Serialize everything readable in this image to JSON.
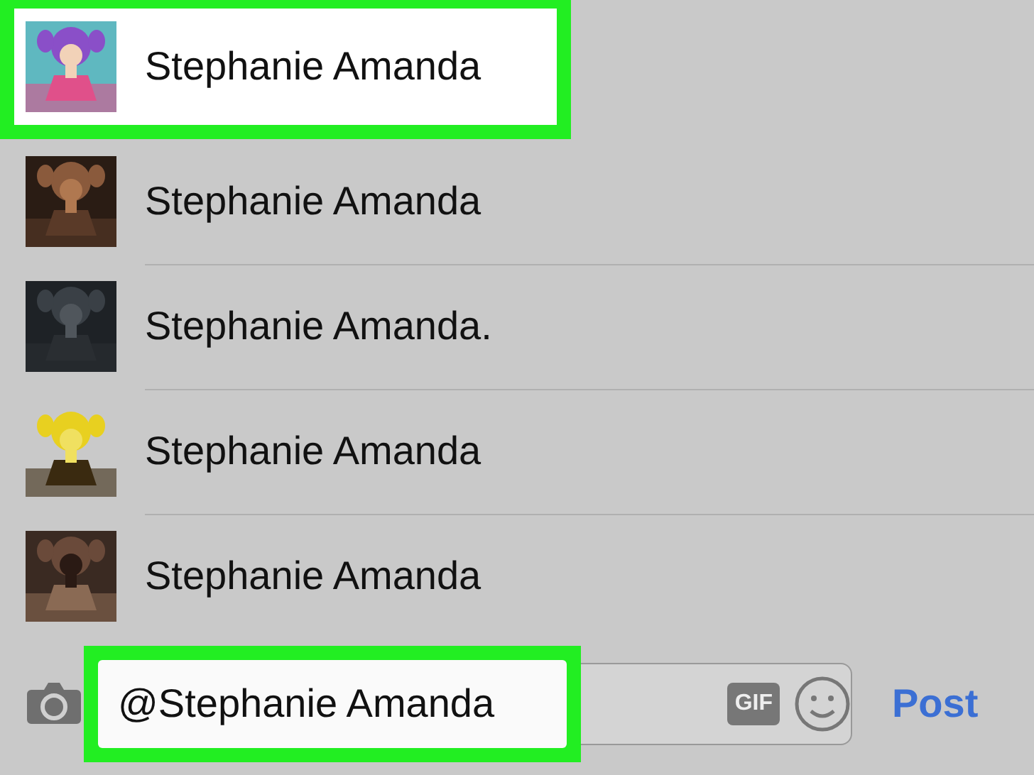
{
  "suggestions": [
    {
      "name": "Stephanie Amanda",
      "selected": true
    },
    {
      "name": "Stephanie Amanda",
      "selected": false
    },
    {
      "name": "Stephanie Amanda.",
      "selected": false
    },
    {
      "name": "Stephanie Amanda",
      "selected": false
    },
    {
      "name": "Stephanie Amanda",
      "selected": false
    }
  ],
  "composer": {
    "value": "@Stephanie Amanda",
    "highlighted": true,
    "gif": "GIF",
    "post": "Post"
  }
}
